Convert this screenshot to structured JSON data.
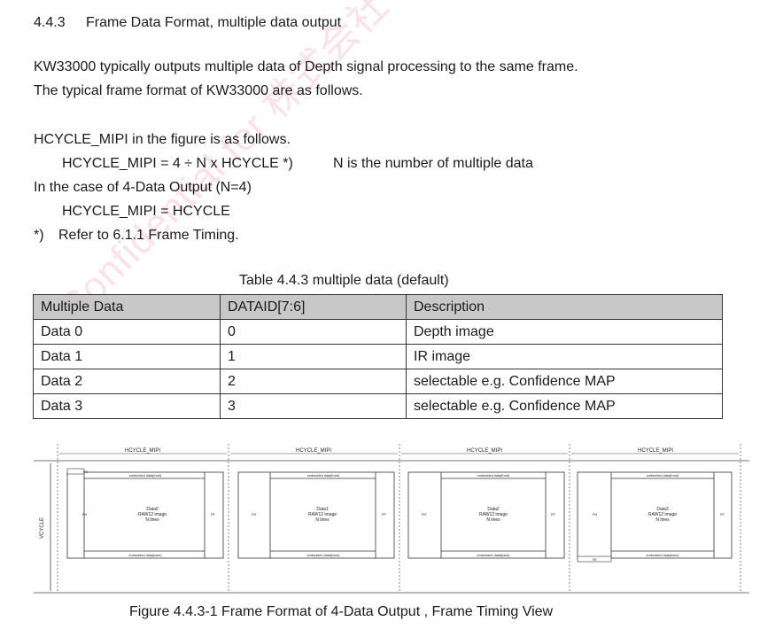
{
  "section": {
    "number": "4.4.3",
    "title": "Frame Data Format, multiple data output"
  },
  "paragraphs": {
    "p1": "KW33000 typically outputs multiple data of Depth signal processing to the same frame.",
    "p2": "The typical frame format of KW33000 are as follows.",
    "p3": "HCYCLE_MIPI in the figure is as follows.",
    "formula1": "HCYCLE_MIPI = 4 ÷ N x HCYCLE *)",
    "formula1_note": "N is the number of multiple data",
    "p4": "In the case of 4-Data Output (N=4)",
    "formula2": "HCYCLE_MIPI = HCYCLE",
    "footnote_mark": "*)",
    "footnote_text": "Refer to 6.1.1 Frame Timing."
  },
  "table": {
    "caption": "Table 4.4.3   multiple data (default)",
    "headers": [
      "Multiple Data",
      "DATAID[7:6]",
      "Description"
    ],
    "rows": [
      [
        "Data 0",
        "0",
        "Depth image"
      ],
      [
        "Data 1",
        "1",
        "IR image"
      ],
      [
        "Data 2",
        "2",
        "selectable    e.g. Confidence MAP"
      ],
      [
        "Data 3",
        "3",
        "selectable    e.g. Confidence MAP"
      ]
    ]
  },
  "watermark": "Confidential for 株式会社 Preferred Ro",
  "figure": {
    "caption": "Figure 4.4.3-1   Frame Format of 4-Data Output , Frame Timing View",
    "hcycle_label": "HCYCLE_MIPI",
    "vcycle_label": "VCYCLE",
    "fs_label": "FS",
    "fe_label": "FE",
    "ph_label": "PH",
    "pf_label": "PF",
    "embedded_front": "embedded data(front)",
    "embedded_back": "embedded data(back)",
    "raw_label": "RAW12 image",
    "lines_label": "N lines",
    "blocks": [
      {
        "name": "Data0"
      },
      {
        "name": "Data1"
      },
      {
        "name": "Data2"
      },
      {
        "name": "Data3"
      }
    ]
  }
}
